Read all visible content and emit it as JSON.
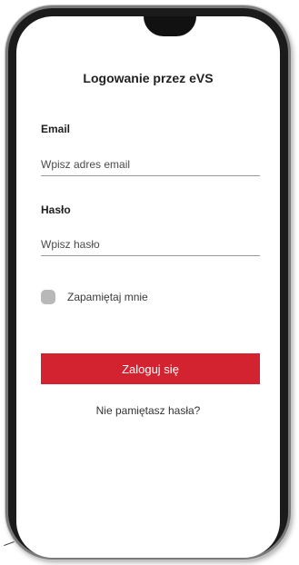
{
  "login": {
    "title": "Logowanie przez eVS",
    "email_label": "Email",
    "email_placeholder": "Wpisz adres email",
    "email_value": "",
    "password_label": "Hasło",
    "password_placeholder": "Wpisz hasło",
    "password_value": "",
    "remember_label": "Zapamiętaj mnie",
    "remember_checked": false,
    "submit_label": "Zaloguj się",
    "forgot_label": "Nie pamiętasz hasła?"
  },
  "colors": {
    "accent": "#d42330",
    "checkbox": "#b8b8b8",
    "frame": "#1b1b1b"
  }
}
